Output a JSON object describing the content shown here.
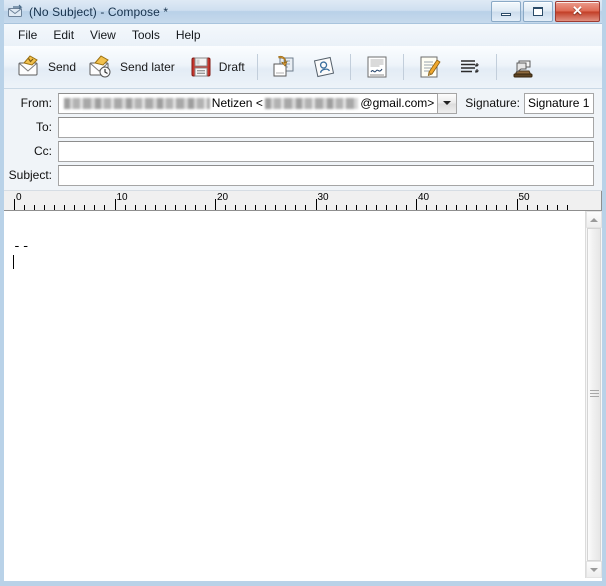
{
  "window": {
    "title": "(No Subject) - Compose *",
    "icon": "compose-envelope-icon",
    "buttons": {
      "minimize": "–",
      "maximize": "□",
      "close": "✕"
    }
  },
  "menubar": {
    "items": [
      {
        "label": "File"
      },
      {
        "label": "Edit"
      },
      {
        "label": "View"
      },
      {
        "label": "Tools"
      },
      {
        "label": "Help"
      }
    ]
  },
  "toolbar": {
    "buttons": [
      {
        "label": "Send",
        "icon": "send-envelope-icon"
      },
      {
        "label": "Send later",
        "icon": "send-later-clock-envelope-icon"
      },
      {
        "label": "Draft",
        "icon": "floppy-disk-save-icon"
      },
      {
        "label": "",
        "icon": "attach-file-icon"
      },
      {
        "label": "",
        "icon": "attach-contact-card-icon"
      },
      {
        "label": "",
        "icon": "signature-note-icon"
      },
      {
        "label": "",
        "icon": "edit-pencil-note-icon"
      },
      {
        "label": "",
        "icon": "format-paragraph-icon"
      },
      {
        "label": "",
        "icon": "print-stamp-icon"
      }
    ]
  },
  "fields": {
    "from": {
      "label": "From:",
      "redacted_name": "",
      "visible_name": "Netizen <",
      "redacted_address": "",
      "domain": "@gmail.com>"
    },
    "signature": {
      "label": "Signature:",
      "value": "Signature 1"
    },
    "to": {
      "label": "To:",
      "value": "",
      "placeholder": ""
    },
    "cc": {
      "label": "Cc:",
      "value": "",
      "placeholder": ""
    },
    "subject": {
      "label": "Subject:",
      "value": "",
      "placeholder": ""
    }
  },
  "ruler": {
    "labels": [
      "0",
      "10",
      "20",
      "30",
      "40",
      "50"
    ]
  },
  "body": {
    "signature_separator": "--",
    "content": ""
  },
  "scrollbar": {
    "up_arrow": "▲",
    "down_arrow": "▼"
  },
  "colors": {
    "titlebar_top": "#dfeaf5",
    "titlebar_bottom": "#c6d9ec",
    "frame": "#b9d2e8",
    "close_button": "#c23d26",
    "field_border": "#a6a6a6",
    "text": "#101010"
  }
}
